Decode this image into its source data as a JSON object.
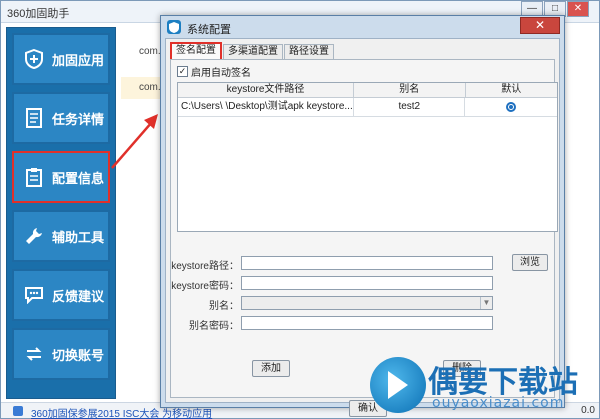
{
  "app": {
    "title": "360加固助手",
    "controls": {
      "minimize": "—",
      "maximize": "□",
      "close": "✕"
    }
  },
  "sidebar": {
    "items": [
      {
        "label": "加固应用",
        "icon": "shield-plus-icon",
        "active": false
      },
      {
        "label": "任务详情",
        "icon": "document-list-icon",
        "active": false
      },
      {
        "label": "配置信息",
        "icon": "clipboard-icon",
        "active": true
      },
      {
        "label": "辅助工具",
        "icon": "wrench-icon",
        "active": false
      },
      {
        "label": "反馈建议",
        "icon": "chat-bubble-icon",
        "active": false
      },
      {
        "label": "切换账号",
        "icon": "switch-account-icon",
        "active": false
      }
    ]
  },
  "list": {
    "rows": [
      "com.ex",
      "com.exa"
    ]
  },
  "status": {
    "link": "360加固保参展2015 ISC大会 为移动应用",
    "version": "0.0"
  },
  "dialog": {
    "title": "系统配置",
    "close_label": "✕",
    "tabs": [
      {
        "label": "签名配置",
        "active": true
      },
      {
        "label": "多渠道配置",
        "active": false
      },
      {
        "label": "路径设置",
        "active": false
      }
    ],
    "auto_sign": {
      "label": "启用自动签名",
      "checked": true,
      "mark": "✓"
    },
    "table": {
      "headers": [
        "keystore文件路径",
        "别名",
        "默认"
      ],
      "rows": [
        {
          "path": "C:\\Users\\          \\Desktop\\测试apk keystore...",
          "alias": "test2",
          "default": true
        }
      ]
    },
    "form": {
      "path_label": "keystore路径：",
      "password_label": "keystore密码：",
      "alias_label": "别名：",
      "alias_password_label": "别名密码：",
      "browse_label": "浏览",
      "add_label": "添加",
      "delete_label": "删除",
      "ok_label": "确认"
    }
  },
  "watermark": {
    "title": "偶要下载站",
    "subtitle": "ouyaoxiazai.com"
  },
  "colors": {
    "sidebar_bg": "#1a6faa",
    "sidebar_btn": "#2c86c4",
    "highlight_red": "#e0302a",
    "dialog_frame": "#ccdcec"
  }
}
